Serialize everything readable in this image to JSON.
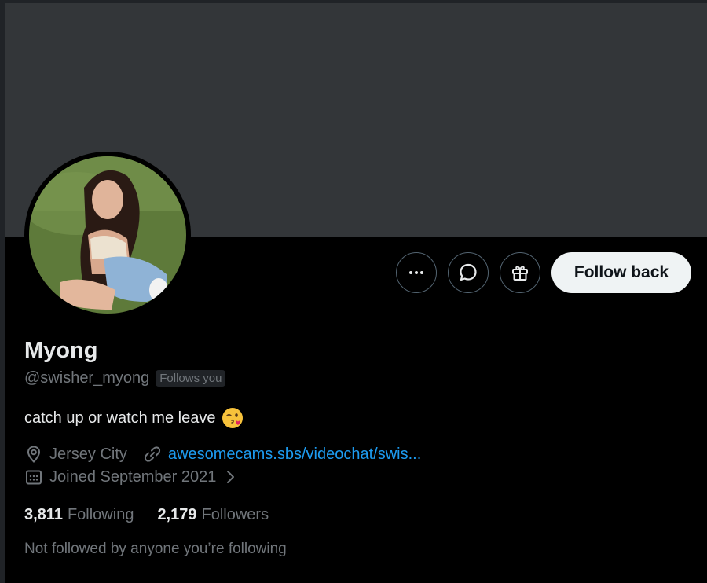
{
  "colors": {
    "background": "#000000",
    "banner": "#333639",
    "primary_text": "#e7e9ea",
    "secondary_text": "#71767b",
    "link": "#1d9bf0",
    "follow_button_bg": "#eff3f4"
  },
  "profile": {
    "name": "Myong",
    "handle": "@swisher_myong",
    "follows_you_badge": "Follows you",
    "bio": "catch up or watch me leave",
    "bio_emoji": "kissing-winking-face-emoji",
    "location": "Jersey City",
    "website": "awesomecams.sbs/videochat/swis...",
    "joined": "Joined September 2021"
  },
  "actions": {
    "more_icon": "more-horizontal-icon",
    "message_icon": "chat-bubble-icon",
    "gift_icon": "gift-icon",
    "follow_back_label": "Follow back"
  },
  "stats": {
    "following_count": "3,811",
    "following_label": "Following",
    "followers_count": "2,179",
    "followers_label": "Followers"
  },
  "footer": {
    "not_followed_text": "Not followed by anyone you’re following"
  }
}
